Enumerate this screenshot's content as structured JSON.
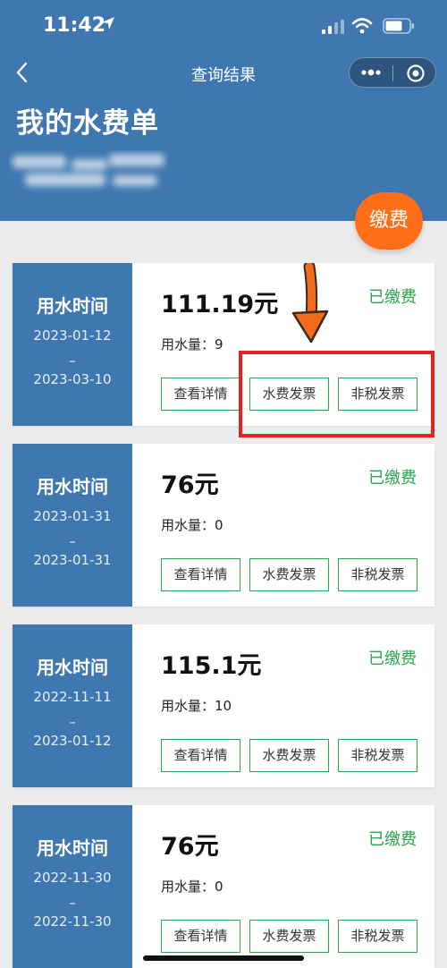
{
  "status_bar": {
    "time": "11:42"
  },
  "nav": {
    "title": "查询结果"
  },
  "header": {
    "page_title": "我的水费单"
  },
  "pay_button_label": "缴费",
  "bills": [
    {
      "label": "用水时间",
      "start": "2023-01-12",
      "dash": "–",
      "end": "2023-03-10",
      "amount": "111.19元",
      "usage": "用水量：9",
      "status": "已缴费",
      "btn_detail": "查看详情",
      "btn_water": "水费发票",
      "btn_nontax": "非税发票"
    },
    {
      "label": "用水时间",
      "start": "2023-01-31",
      "dash": "–",
      "end": "2023-01-31",
      "amount": "76元",
      "usage": "用水量：0",
      "status": "已缴费",
      "btn_detail": "查看详情",
      "btn_water": "水费发票",
      "btn_nontax": "非税发票"
    },
    {
      "label": "用水时间",
      "start": "2022-11-11",
      "dash": "–",
      "end": "2023-01-12",
      "amount": "115.1元",
      "usage": "用水量：10",
      "status": "已缴费",
      "btn_detail": "查看详情",
      "btn_water": "水费发票",
      "btn_nontax": "非税发票"
    },
    {
      "label": "用水时间",
      "start": "2022-11-30",
      "dash": "–",
      "end": "2022-11-30",
      "amount": "76元",
      "usage": "用水量：0",
      "status": "已缴费",
      "btn_detail": "查看详情",
      "btn_water": "水费发票",
      "btn_nontax": "非税发票"
    }
  ],
  "colors": {
    "header_bg": "#3f77b0",
    "pay_button": "#ff6f1a",
    "status_green": "#2da44e",
    "annotation_red": "#e32222",
    "annotation_arrow": "#f26a1b"
  },
  "icons": [
    "location-arrow-icon",
    "signal-icon",
    "wifi-icon",
    "battery-icon",
    "back-icon",
    "more-icon",
    "close-icon",
    "annotation-arrow-icon"
  ]
}
